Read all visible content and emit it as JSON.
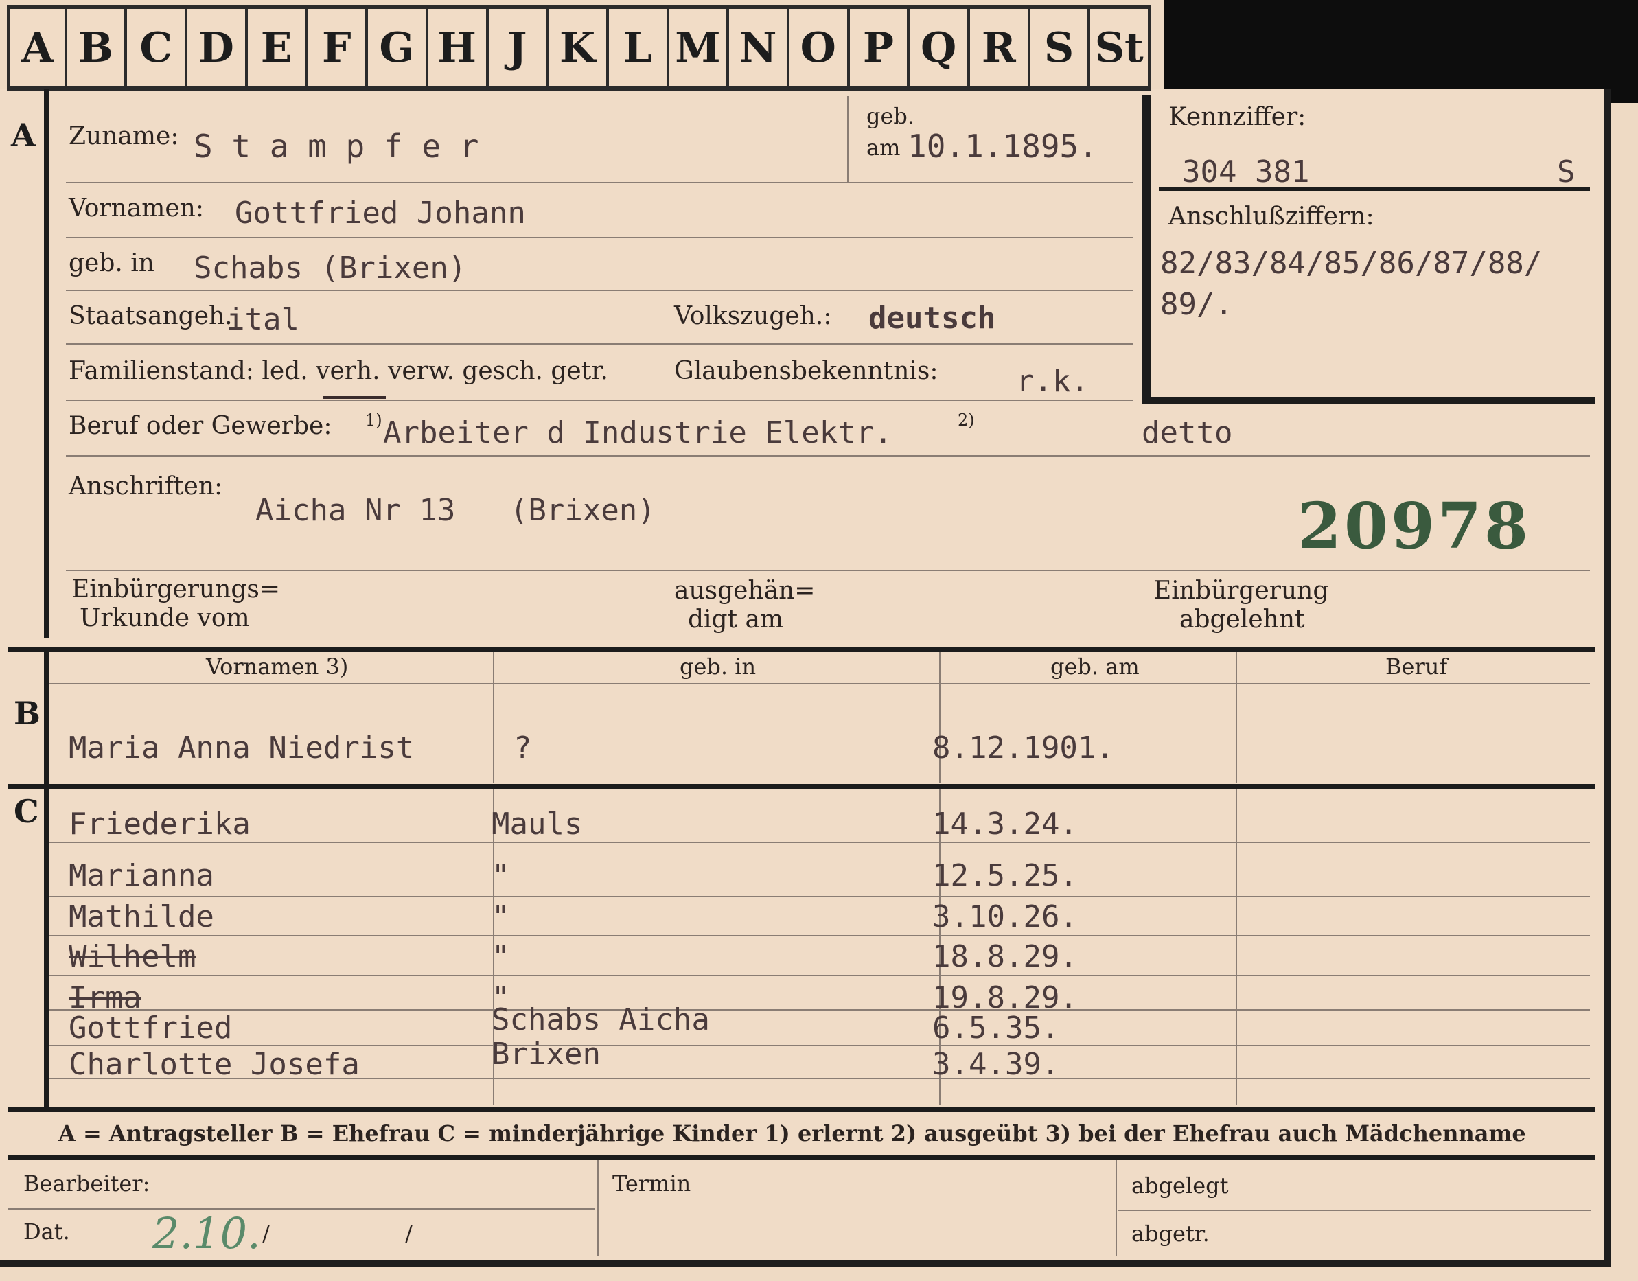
{
  "tabs": [
    "A",
    "B",
    "C",
    "D",
    "E",
    "F",
    "G",
    "H",
    "J",
    "K",
    "L",
    "M",
    "N",
    "O",
    "P",
    "Q",
    "R",
    "S",
    "St"
  ],
  "section_a": {
    "marker": "A",
    "surname_label": "Zuname:",
    "surname": "S t a m p f e r",
    "born_label_1": "geb.",
    "born_label_2": "am",
    "born_date": "10.1.1895.",
    "firstnames_label": "Vornamen:",
    "firstnames": "Gottfried Johann",
    "birthplace_label": "geb. in",
    "birthplace": "Schabs (Brixen)",
    "citizenship_label": "Staatsangeh.",
    "citizenship": "ital",
    "nationality_label": "Volkszugeh.:",
    "nationality": "deutsch",
    "family_status_label": "Familienstand: led. verh. verw. gesch. getr.",
    "religion_label": "Glaubensbekenntnis:",
    "religion": "r.k.",
    "occupation_label": "Beruf oder Gewerbe:",
    "occupation_note_1": "1)",
    "occupation": "Arbeiter d Industrie Elektr.",
    "occupation_note_2": "2)",
    "occupation_practiced": "detto",
    "address_label": "Anschriften:",
    "address": "Aicha Nr 13   (Brixen)",
    "stamp_number": "20978",
    "naturalization_label_1": "Einbürgerungs=",
    "naturalization_label_2": "Urkunde vom",
    "handed_label_1": "ausgehän=",
    "handed_label_2": "digt am",
    "rejected_label_1": "Einbürgerung",
    "rejected_label_2": "abgelehnt"
  },
  "id_box": {
    "id_label": "Kennziffer:",
    "id_value": "304 381",
    "id_suffix": "S",
    "links_label": "Anschlußziffern:",
    "links_line_1": "82/83/84/85/86/87/88/",
    "links_line_2": "89/."
  },
  "section_b": {
    "marker": "B",
    "headers": [
      "Vornamen 3)",
      "geb. in",
      "geb. am",
      "Beruf"
    ],
    "row": {
      "name": "Maria Anna Niedrist",
      "place": "?",
      "date": "8.12.1901.",
      "job": ""
    }
  },
  "section_c": {
    "marker": "C",
    "children": [
      {
        "name": "Friederika",
        "place": "Mauls",
        "date": "14.3.24.",
        "struck": false
      },
      {
        "name": "Marianna",
        "place": "\"",
        "date": "12.5.25.",
        "struck": false
      },
      {
        "name": "Mathilde",
        "place": "\"",
        "date": "3.10.26.",
        "struck": false
      },
      {
        "name": "Wilhelm",
        "place": "\"",
        "date": "18.8.29.",
        "struck": true
      },
      {
        "name": "Irma",
        "place": "\"",
        "date": "19.8.29.",
        "struck": true
      },
      {
        "name": "Gottfried",
        "place": "Schabs Aicha",
        "date": "6.5.35.",
        "struck": false
      },
      {
        "name": "Charlotte Josefa",
        "place": "Brixen",
        "date": "3.4.39.",
        "struck": false
      }
    ]
  },
  "legend": "A = Antragsteller   B = Ehefrau   C = minderjährige Kinder   1) erlernt   2) ausgeübt   3) bei der Ehefrau auch Mädchenname",
  "footer": {
    "clerk_label": "Bearbeiter:",
    "date_label": "Dat.",
    "date_pencil": "2.10.",
    "slash_1": "/",
    "slash_2": "/",
    "deadline_label": "Termin",
    "filed_label": "abgelegt",
    "separated_label": "abgetr."
  }
}
